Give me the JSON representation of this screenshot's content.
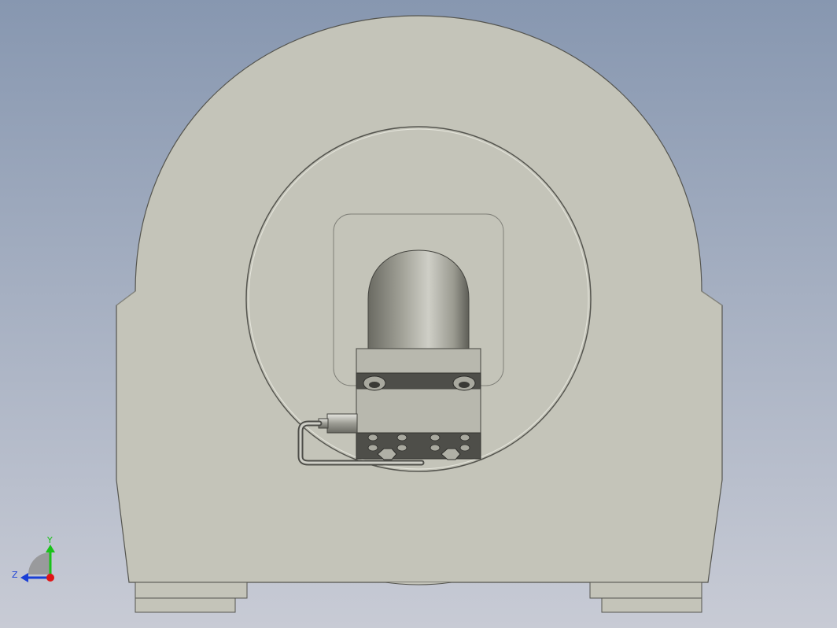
{
  "viewport": {
    "background_top": "#8a9bb3",
    "background_bottom": "#c9ccd6",
    "part_color": "#c3c3b8",
    "part_edge": "#4a4a46",
    "cylinder_dark": "#6c6c64",
    "cylinder_light": "#c8c8c0",
    "block_color": "#b6b6ac",
    "block_dark": "#55554f"
  },
  "triad": {
    "y_label": "Y",
    "z_label": "Z",
    "y_color": "#19c219",
    "z_color": "#1a3fd6",
    "x_color": "#e01515"
  }
}
